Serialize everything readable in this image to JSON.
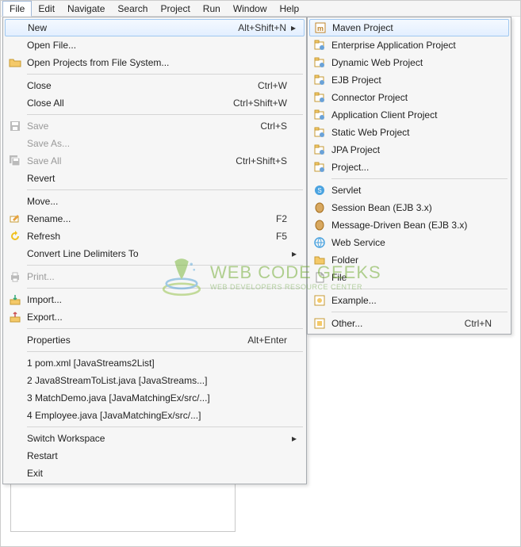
{
  "menubar": [
    "File",
    "Edit",
    "Navigate",
    "Search",
    "Project",
    "Run",
    "Window",
    "Help"
  ],
  "fileMenu": {
    "groups": [
      [
        {
          "label": "New",
          "accel": "Alt+Shift+N",
          "submenu": true,
          "highlight": true,
          "icon": null
        },
        {
          "label": "Open File...",
          "icon": null
        },
        {
          "label": "Open Projects from File System...",
          "icon": "folder-open"
        }
      ],
      [
        {
          "label": "Close",
          "accel": "Ctrl+W"
        },
        {
          "label": "Close All",
          "accel": "Ctrl+Shift+W"
        }
      ],
      [
        {
          "label": "Save",
          "accel": "Ctrl+S",
          "icon": "save",
          "dim": true
        },
        {
          "label": "Save As...",
          "dim": true
        },
        {
          "label": "Save All",
          "accel": "Ctrl+Shift+S",
          "icon": "save-all",
          "dim": true
        },
        {
          "label": "Revert"
        }
      ],
      [
        {
          "label": "Move..."
        },
        {
          "label": "Rename...",
          "accel": "F2",
          "icon": "rename"
        },
        {
          "label": "Refresh",
          "accel": "F5",
          "icon": "refresh"
        },
        {
          "label": "Convert Line Delimiters To",
          "submenu": true
        }
      ],
      [
        {
          "label": "Print...",
          "icon": "print",
          "dim": true
        }
      ],
      [
        {
          "label": "Import...",
          "icon": "import"
        },
        {
          "label": "Export...",
          "icon": "export"
        }
      ],
      [
        {
          "label": "Properties",
          "accel": "Alt+Enter"
        }
      ],
      [
        {
          "label": "1 pom.xml  [JavaStreams2List]"
        },
        {
          "label": "2 Java8StreamToList.java  [JavaStreams...]"
        },
        {
          "label": "3 MatchDemo.java  [JavaMatchingEx/src/...]"
        },
        {
          "label": "4 Employee.java  [JavaMatchingEx/src/...]"
        }
      ],
      [
        {
          "label": "Switch Workspace",
          "submenu": true
        },
        {
          "label": "Restart"
        },
        {
          "label": "Exit"
        }
      ]
    ]
  },
  "newSubmenu": {
    "groups": [
      [
        {
          "label": "Maven Project",
          "icon": "maven",
          "highlight": true
        },
        {
          "label": "Enterprise Application Project",
          "icon": "proj-ear"
        },
        {
          "label": "Dynamic Web Project",
          "icon": "proj-web"
        },
        {
          "label": "EJB Project",
          "icon": "proj-ejb"
        },
        {
          "label": "Connector Project",
          "icon": "proj-conn"
        },
        {
          "label": "Application Client Project",
          "icon": "proj-app"
        },
        {
          "label": "Static Web Project",
          "icon": "proj-static"
        },
        {
          "label": "JPA Project",
          "icon": "proj-jpa"
        },
        {
          "label": "Project...",
          "icon": "proj-generic"
        }
      ],
      [
        {
          "label": "Servlet",
          "icon": "servlet"
        },
        {
          "label": "Session Bean (EJB 3.x)",
          "icon": "bean"
        },
        {
          "label": "Message-Driven Bean (EJB 3.x)",
          "icon": "bean"
        },
        {
          "label": "Web Service",
          "icon": "ws"
        },
        {
          "label": "Folder",
          "icon": "folder"
        },
        {
          "label": "File",
          "icon": "file"
        }
      ],
      [
        {
          "label": "Example...",
          "icon": "example"
        }
      ],
      [
        {
          "label": "Other...",
          "accel": "Ctrl+N",
          "icon": "other"
        }
      ]
    ]
  },
  "watermark": {
    "line1": "WEB CODE GEEKS",
    "line2": "WEB DEVELOPERS RESOURCE CENTER"
  }
}
